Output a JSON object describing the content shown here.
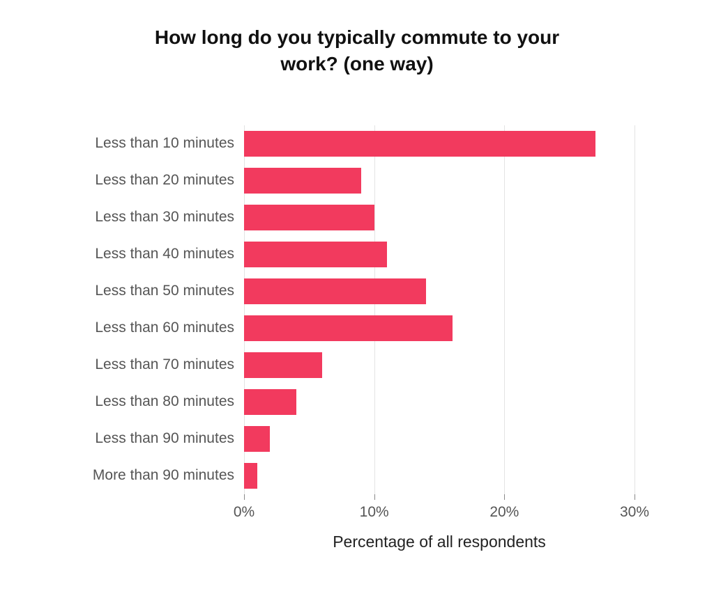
{
  "chart_data": {
    "type": "bar",
    "orientation": "horizontal",
    "title": "How long do you typically commute to your work? (one way)",
    "xlabel": "Percentage of all respondents",
    "ylabel": "",
    "categories": [
      "Less than 10 minutes",
      "Less than 20 minutes",
      "Less than 30 minutes",
      "Less than 40 minutes",
      "Less than 50 minutes",
      "Less than 60 minutes",
      "Less than 70 minutes",
      "Less than 80 minutes",
      "Less than 90 minutes",
      "More than 90 minutes"
    ],
    "values": [
      27,
      9,
      10,
      11,
      14,
      16,
      6,
      4,
      2,
      1
    ],
    "value_unit": "percent",
    "xlim": [
      0,
      30
    ],
    "x_ticks": [
      0,
      10,
      20,
      30
    ],
    "x_tick_labels": [
      "0%",
      "10%",
      "20%",
      "30%"
    ],
    "bar_color": "#f23a5e",
    "grid": true
  },
  "title_lines": {
    "line1": "How long do you typically commute to your",
    "line2": "work? (one way)"
  }
}
